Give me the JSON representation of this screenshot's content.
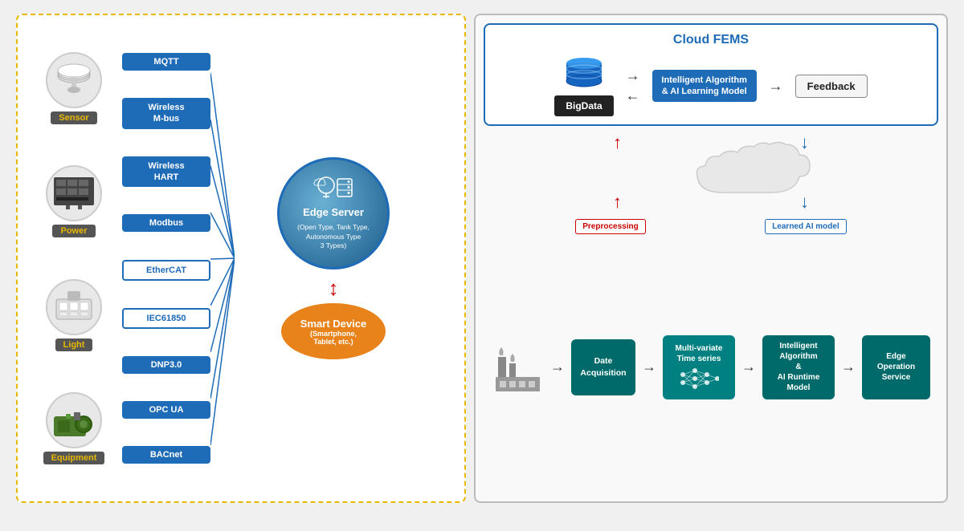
{
  "left_panel": {
    "devices": [
      {
        "label": "Sensor",
        "icon": "📡"
      },
      {
        "label": "Power",
        "icon": "🖥️"
      },
      {
        "label": "Light",
        "icon": "💡"
      },
      {
        "label": "Equipment",
        "icon": "⚙️"
      }
    ],
    "protocols": [
      {
        "name": "MQTT",
        "outlined": false
      },
      {
        "name": "Wireless M-bus",
        "outlined": false
      },
      {
        "name": "Wireless HART",
        "outlined": false
      },
      {
        "name": "Modbus",
        "outlined": false
      },
      {
        "name": "EtherCAT",
        "outlined": true
      },
      {
        "name": "IEC61850",
        "outlined": true
      },
      {
        "name": "DNP3.0",
        "outlined": false
      },
      {
        "name": "OPC UA",
        "outlined": false
      },
      {
        "name": "BACnet",
        "outlined": false
      }
    ],
    "edge_server": {
      "title": "Edge Server",
      "subtitle": "(Open Type, Tank Type, Autonomous Type 3 Types)"
    },
    "smart_device": {
      "title": "Smart Device",
      "subtitle": "(Smartphone, Tablet, etc.)"
    }
  },
  "right_panel": {
    "cloud_fems": {
      "title": "Cloud FEMS",
      "bigdata_label": "BigData",
      "ai_label": "Intelligent Algorithm\n& AI Learning Model",
      "feedback_label": "Feedback"
    },
    "bottom_items": [
      {
        "label": "Date\nAcquisition"
      },
      {
        "label": "Multi-variate\nTime series"
      },
      {
        "label": "Intelligent\nAlgorithm\n&\nAI Runtime\nModel"
      },
      {
        "label": "Edge\nOperation\nService"
      }
    ],
    "preprocessing_label": "Preprocessing",
    "learned_ai_label": "Learned AI model"
  }
}
